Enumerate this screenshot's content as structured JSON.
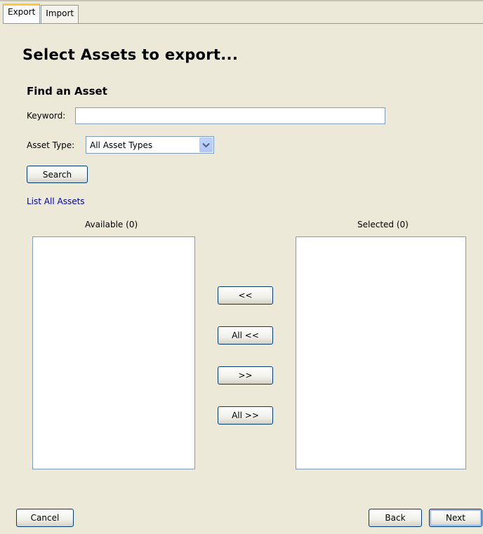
{
  "tabs": [
    {
      "label": "Export",
      "active": true
    },
    {
      "label": "Import",
      "active": false
    }
  ],
  "page_title": "Select Assets to export...",
  "find": {
    "section_title": "Find an Asset",
    "keyword_label": "Keyword:",
    "keyword_value": "",
    "asset_type_label": "Asset Type:",
    "asset_type_value": "All Asset Types",
    "search_button": "Search",
    "list_all_link": "List All Assets"
  },
  "lists": {
    "available_label": "Available (0)",
    "selected_label": "Selected (0)"
  },
  "transfer_buttons": {
    "remove": "<<",
    "remove_all": "All <<",
    "add": ">>",
    "add_all": "All >>"
  },
  "footer": {
    "cancel": "Cancel",
    "back": "Back",
    "next": "Next"
  },
  "colors": {
    "background": "#ece9d8",
    "active_tab_accent": "#ffc83c",
    "link": "#0000a0",
    "input_border": "#7f9db9",
    "button_border": "#003c74"
  },
  "icons": {
    "dropdown": "chevron-down-icon"
  }
}
